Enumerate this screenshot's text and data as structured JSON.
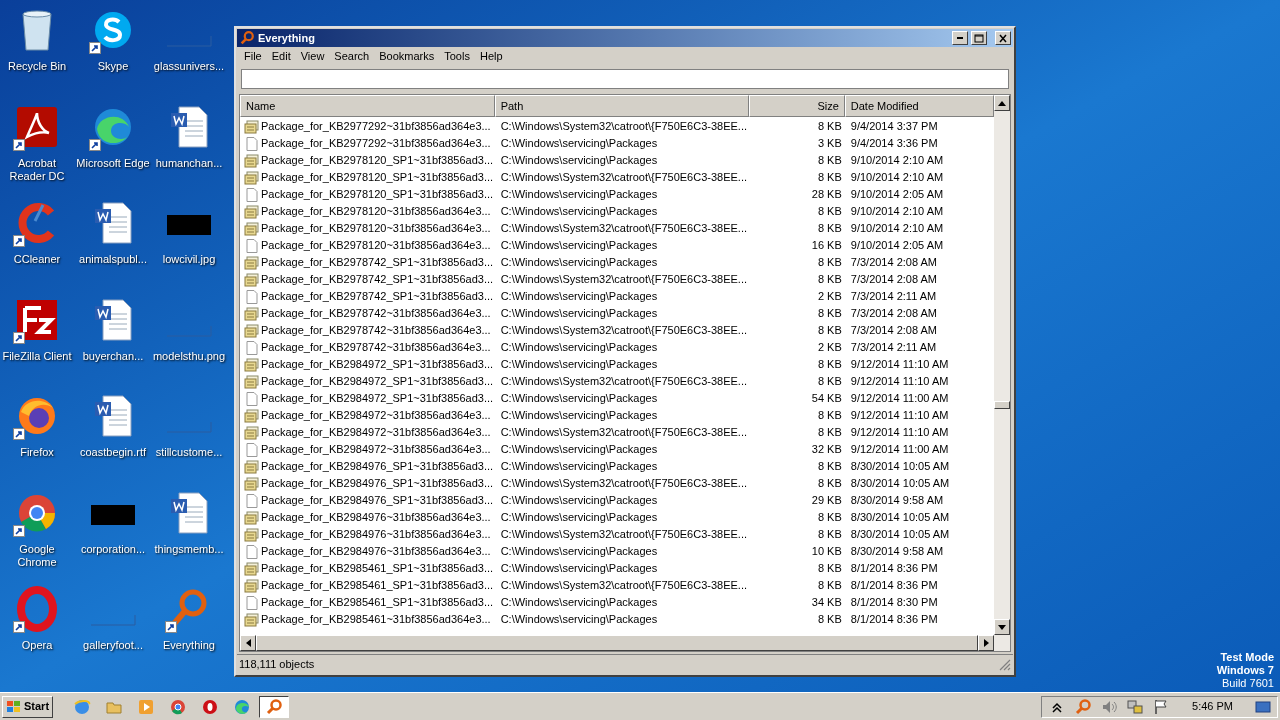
{
  "desktop": {
    "icons": [
      {
        "label": "Recycle Bin",
        "kind": "recycle",
        "shortcut": false
      },
      {
        "label": "Acrobat Reader DC",
        "kind": "pdf",
        "shortcut": true
      },
      {
        "label": "CCleaner",
        "kind": "ccleaner",
        "shortcut": true
      },
      {
        "label": "FileZilla Client",
        "kind": "filezilla",
        "shortcut": true
      },
      {
        "label": "Firefox",
        "kind": "firefox",
        "shortcut": true
      },
      {
        "label": "Google Chrome",
        "kind": "chrome",
        "shortcut": true
      },
      {
        "label": "Opera",
        "kind": "opera",
        "shortcut": true
      },
      {
        "label": "Skype",
        "kind": "skype",
        "shortcut": true
      },
      {
        "label": "Microsoft Edge",
        "kind": "edge",
        "shortcut": true
      },
      {
        "label": "animalspubl...",
        "kind": "word",
        "shortcut": false
      },
      {
        "label": "buyerchan...",
        "kind": "word",
        "shortcut": false
      },
      {
        "label": "coastbegin.rtf",
        "kind": "word",
        "shortcut": false
      },
      {
        "label": "corporation...",
        "kind": "black",
        "shortcut": false
      },
      {
        "label": "galleryfoot...",
        "kind": "blank",
        "shortcut": false
      },
      {
        "label": "glassunivers...",
        "kind": "blank",
        "shortcut": false
      },
      {
        "label": "humanchan...",
        "kind": "word",
        "shortcut": false
      },
      {
        "label": "lowcivil.jpg",
        "kind": "black",
        "shortcut": false
      },
      {
        "label": "modelsthu.png",
        "kind": "blank",
        "shortcut": false
      },
      {
        "label": "stillcustome...",
        "kind": "blank",
        "shortcut": false
      },
      {
        "label": "thingsmemb...",
        "kind": "word",
        "shortcut": false
      },
      {
        "label": "Everything",
        "kind": "everything",
        "shortcut": true
      }
    ],
    "os_notice": [
      {
        "text": "Test Mode",
        "bold": true
      },
      {
        "text": "Windows 7",
        "bold": true
      },
      {
        "text": "Build 7601",
        "bold": false
      }
    ]
  },
  "window": {
    "title": "Everything",
    "menu": [
      "File",
      "Edit",
      "View",
      "Search",
      "Bookmarks",
      "Tools",
      "Help"
    ],
    "columns": [
      "Name",
      "Path",
      "Size",
      "Date Modified"
    ],
    "rows": [
      {
        "kind": "catalog",
        "name": "Package_for_KB2977292~31bf3856ad364e3...",
        "path": "C:\\Windows\\System32\\catroot\\{F750E6C3-38EE...",
        "size": "8 KB",
        "date": "9/4/2014 3:37 PM"
      },
      {
        "kind": "file",
        "name": "Package_for_KB2977292~31bf3856ad364e3...",
        "path": "C:\\Windows\\servicing\\Packages",
        "size": "3 KB",
        "date": "9/4/2014 3:36 PM"
      },
      {
        "kind": "catalog",
        "name": "Package_for_KB2978120_SP1~31bf3856ad3...",
        "path": "C:\\Windows\\servicing\\Packages",
        "size": "8 KB",
        "date": "9/10/2014 2:10 AM"
      },
      {
        "kind": "catalog",
        "name": "Package_for_KB2978120_SP1~31bf3856ad3...",
        "path": "C:\\Windows\\System32\\catroot\\{F750E6C3-38EE...",
        "size": "8 KB",
        "date": "9/10/2014 2:10 AM"
      },
      {
        "kind": "file",
        "name": "Package_for_KB2978120_SP1~31bf3856ad3...",
        "path": "C:\\Windows\\servicing\\Packages",
        "size": "28 KB",
        "date": "9/10/2014 2:05 AM"
      },
      {
        "kind": "catalog",
        "name": "Package_for_KB2978120~31bf3856ad364e3...",
        "path": "C:\\Windows\\servicing\\Packages",
        "size": "8 KB",
        "date": "9/10/2014 2:10 AM"
      },
      {
        "kind": "catalog",
        "name": "Package_for_KB2978120~31bf3856ad364e3...",
        "path": "C:\\Windows\\System32\\catroot\\{F750E6C3-38EE...",
        "size": "8 KB",
        "date": "9/10/2014 2:10 AM"
      },
      {
        "kind": "file",
        "name": "Package_for_KB2978120~31bf3856ad364e3...",
        "path": "C:\\Windows\\servicing\\Packages",
        "size": "16 KB",
        "date": "9/10/2014 2:05 AM"
      },
      {
        "kind": "catalog",
        "name": "Package_for_KB2978742_SP1~31bf3856ad3...",
        "path": "C:\\Windows\\servicing\\Packages",
        "size": "8 KB",
        "date": "7/3/2014 2:08 AM"
      },
      {
        "kind": "catalog",
        "name": "Package_for_KB2978742_SP1~31bf3856ad3...",
        "path": "C:\\Windows\\System32\\catroot\\{F750E6C3-38EE...",
        "size": "8 KB",
        "date": "7/3/2014 2:08 AM"
      },
      {
        "kind": "file",
        "name": "Package_for_KB2978742_SP1~31bf3856ad3...",
        "path": "C:\\Windows\\servicing\\Packages",
        "size": "2 KB",
        "date": "7/3/2014 2:11 AM"
      },
      {
        "kind": "catalog",
        "name": "Package_for_KB2978742~31bf3856ad364e3...",
        "path": "C:\\Windows\\servicing\\Packages",
        "size": "8 KB",
        "date": "7/3/2014 2:08 AM"
      },
      {
        "kind": "catalog",
        "name": "Package_for_KB2978742~31bf3856ad364e3...",
        "path": "C:\\Windows\\System32\\catroot\\{F750E6C3-38EE...",
        "size": "8 KB",
        "date": "7/3/2014 2:08 AM"
      },
      {
        "kind": "file",
        "name": "Package_for_KB2978742~31bf3856ad364e3...",
        "path": "C:\\Windows\\servicing\\Packages",
        "size": "2 KB",
        "date": "7/3/2014 2:11 AM"
      },
      {
        "kind": "catalog",
        "name": "Package_for_KB2984972_SP1~31bf3856ad3...",
        "path": "C:\\Windows\\servicing\\Packages",
        "size": "8 KB",
        "date": "9/12/2014 11:10 AM"
      },
      {
        "kind": "catalog",
        "name": "Package_for_KB2984972_SP1~31bf3856ad3...",
        "path": "C:\\Windows\\System32\\catroot\\{F750E6C3-38EE...",
        "size": "8 KB",
        "date": "9/12/2014 11:10 AM"
      },
      {
        "kind": "file",
        "name": "Package_for_KB2984972_SP1~31bf3856ad3...",
        "path": "C:\\Windows\\servicing\\Packages",
        "size": "54 KB",
        "date": "9/12/2014 11:00 AM"
      },
      {
        "kind": "catalog",
        "name": "Package_for_KB2984972~31bf3856ad364e3...",
        "path": "C:\\Windows\\servicing\\Packages",
        "size": "8 KB",
        "date": "9/12/2014 11:10 AM"
      },
      {
        "kind": "catalog",
        "name": "Package_for_KB2984972~31bf3856ad364e3...",
        "path": "C:\\Windows\\System32\\catroot\\{F750E6C3-38EE...",
        "size": "8 KB",
        "date": "9/12/2014 11:10 AM"
      },
      {
        "kind": "file",
        "name": "Package_for_KB2984972~31bf3856ad364e3...",
        "path": "C:\\Windows\\servicing\\Packages",
        "size": "32 KB",
        "date": "9/12/2014 11:00 AM"
      },
      {
        "kind": "catalog",
        "name": "Package_for_KB2984976_SP1~31bf3856ad3...",
        "path": "C:\\Windows\\servicing\\Packages",
        "size": "8 KB",
        "date": "8/30/2014 10:05 AM"
      },
      {
        "kind": "catalog",
        "name": "Package_for_KB2984976_SP1~31bf3856ad3...",
        "path": "C:\\Windows\\System32\\catroot\\{F750E6C3-38EE...",
        "size": "8 KB",
        "date": "8/30/2014 10:05 AM"
      },
      {
        "kind": "file",
        "name": "Package_for_KB2984976_SP1~31bf3856ad3...",
        "path": "C:\\Windows\\servicing\\Packages",
        "size": "29 KB",
        "date": "8/30/2014 9:58 AM"
      },
      {
        "kind": "catalog",
        "name": "Package_for_KB2984976~31bf3856ad364e3...",
        "path": "C:\\Windows\\servicing\\Packages",
        "size": "8 KB",
        "date": "8/30/2014 10:05 AM"
      },
      {
        "kind": "catalog",
        "name": "Package_for_KB2984976~31bf3856ad364e3...",
        "path": "C:\\Windows\\System32\\catroot\\{F750E6C3-38EE...",
        "size": "8 KB",
        "date": "8/30/2014 10:05 AM"
      },
      {
        "kind": "file",
        "name": "Package_for_KB2984976~31bf3856ad364e3...",
        "path": "C:\\Windows\\servicing\\Packages",
        "size": "10 KB",
        "date": "8/30/2014 9:58 AM"
      },
      {
        "kind": "catalog",
        "name": "Package_for_KB2985461_SP1~31bf3856ad3...",
        "path": "C:\\Windows\\servicing\\Packages",
        "size": "8 KB",
        "date": "8/1/2014 8:36 PM"
      },
      {
        "kind": "catalog",
        "name": "Package_for_KB2985461_SP1~31bf3856ad3...",
        "path": "C:\\Windows\\System32\\catroot\\{F750E6C3-38EE...",
        "size": "8 KB",
        "date": "8/1/2014 8:36 PM"
      },
      {
        "kind": "file",
        "name": "Package_for_KB2985461_SP1~31bf3856ad3...",
        "path": "C:\\Windows\\servicing\\Packages",
        "size": "34 KB",
        "date": "8/1/2014 8:30 PM"
      },
      {
        "kind": "catalog",
        "name": "Package_for_KB2985461~31bf3856ad364e3...",
        "path": "C:\\Windows\\servicing\\Packages",
        "size": "8 KB",
        "date": "8/1/2014 8:36 PM"
      }
    ],
    "status": "118,111 objects"
  },
  "taskbar": {
    "start": "Start",
    "apps": [
      {
        "kind": "ie",
        "selected": false
      },
      {
        "kind": "explorer",
        "selected": false
      },
      {
        "kind": "media",
        "selected": false
      },
      {
        "kind": "chrome",
        "selected": false
      },
      {
        "kind": "opera",
        "selected": false
      },
      {
        "kind": "edge",
        "selected": false
      },
      {
        "kind": "everything",
        "selected": true
      }
    ],
    "tray": [
      {
        "kind": "chevron"
      },
      {
        "kind": "everything"
      },
      {
        "kind": "speaker"
      },
      {
        "kind": "network"
      },
      {
        "kind": "flag"
      }
    ],
    "clock": "5:46 PM"
  }
}
